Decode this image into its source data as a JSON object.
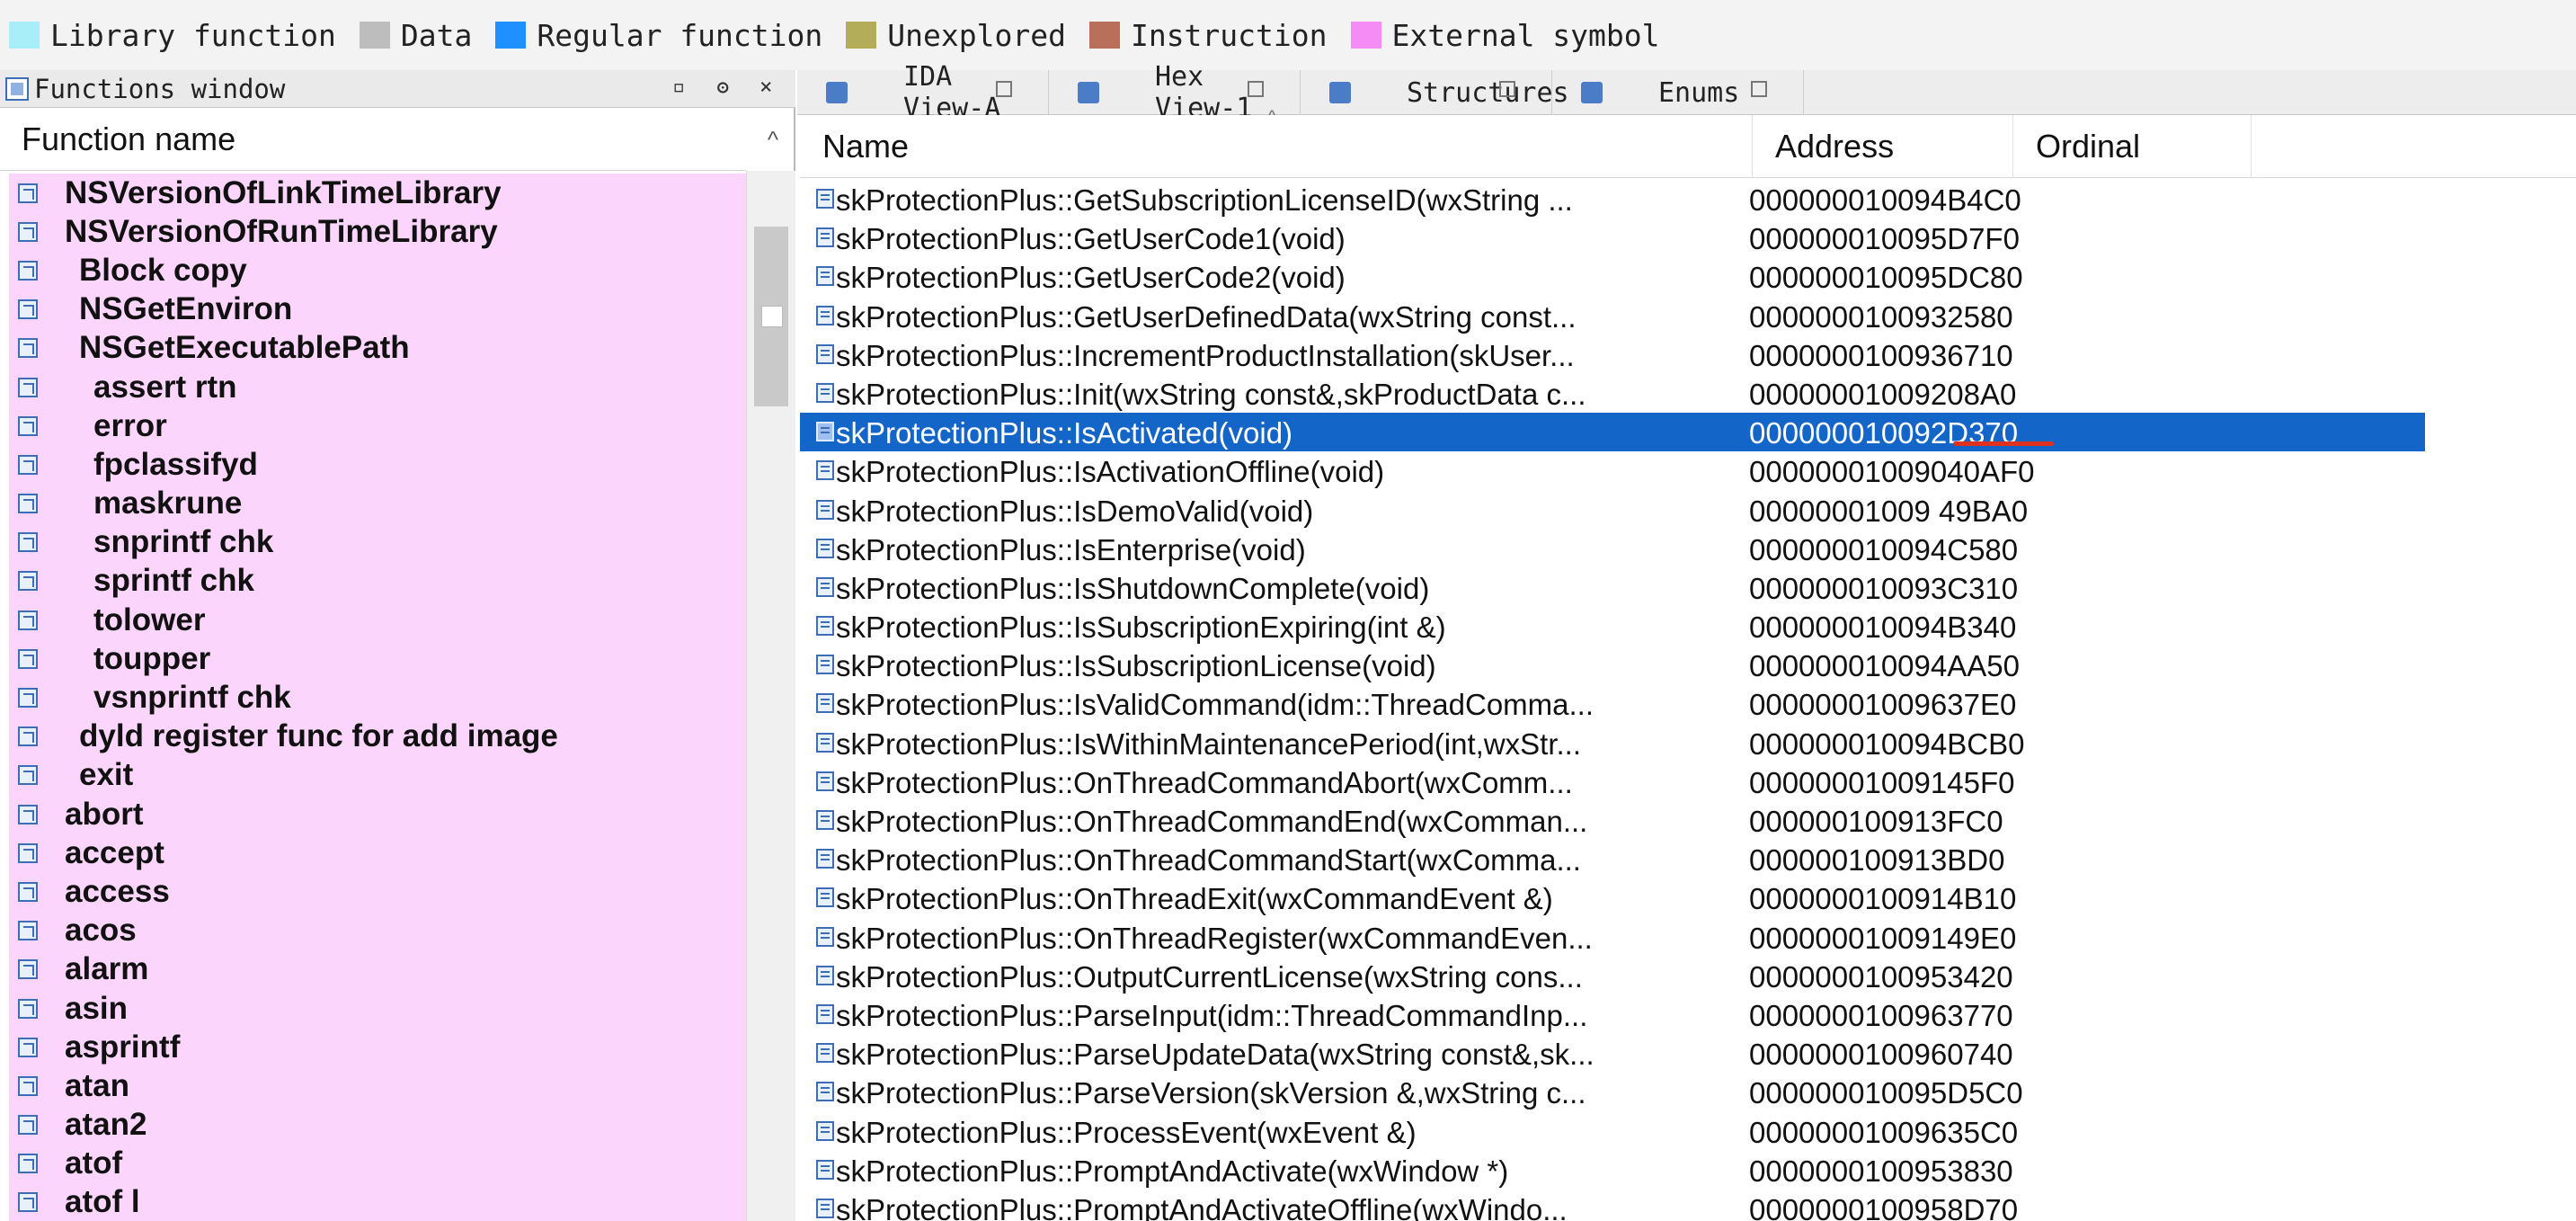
{
  "legend": [
    {
      "label": "Library function",
      "color": "#a8eef8"
    },
    {
      "label": "Data",
      "color": "#bdbdbd"
    },
    {
      "label": "Regular function",
      "color": "#1e90ff"
    },
    {
      "label": "Unexplored",
      "color": "#b3ad5a"
    },
    {
      "label": "Instruction",
      "color": "#b8705a"
    },
    {
      "label": "External symbol",
      "color": "#f58cf5"
    }
  ],
  "functions_window": {
    "title": "Functions window",
    "column_header": "Function name",
    "sort_glyph": "^",
    "controls": [
      "▫",
      "ʘ",
      "×"
    ],
    "items": [
      {
        "name": "NSVersionOfLinkTimeLibrary",
        "indent": 0
      },
      {
        "name": "NSVersionOfRunTimeLibrary",
        "indent": 0
      },
      {
        "name": "Block copy",
        "indent": 1
      },
      {
        "name": "NSGetEnviron",
        "indent": 1
      },
      {
        "name": "NSGetExecutablePath",
        "indent": 1
      },
      {
        "name": "assert rtn",
        "indent": 2
      },
      {
        "name": "error",
        "indent": 2
      },
      {
        "name": "fpclassifyd",
        "indent": 2
      },
      {
        "name": "maskrune",
        "indent": 2
      },
      {
        "name": "snprintf chk",
        "indent": 2
      },
      {
        "name": "sprintf chk",
        "indent": 2
      },
      {
        "name": "tolower",
        "indent": 2
      },
      {
        "name": "toupper",
        "indent": 2
      },
      {
        "name": "vsnprintf chk",
        "indent": 2
      },
      {
        "name": "dyld register func for add image",
        "indent": 1
      },
      {
        "name": "exit",
        "indent": 1
      },
      {
        "name": "abort",
        "indent": 0
      },
      {
        "name": "accept",
        "indent": 0
      },
      {
        "name": "access",
        "indent": 0
      },
      {
        "name": "acos",
        "indent": 0
      },
      {
        "name": "alarm",
        "indent": 0
      },
      {
        "name": "asin",
        "indent": 0
      },
      {
        "name": "asprintf",
        "indent": 0
      },
      {
        "name": "atan",
        "indent": 0
      },
      {
        "name": "atan2",
        "indent": 0
      },
      {
        "name": "atof",
        "indent": 0
      },
      {
        "name": "atof l",
        "indent": 0
      }
    ]
  },
  "tabs": [
    {
      "label": "IDA View-A",
      "icon": "ida-view-icon"
    },
    {
      "label": "Hex View-1",
      "icon": "hex-view-icon"
    },
    {
      "label": "Structures",
      "icon": "structures-icon"
    },
    {
      "label": "Enums",
      "icon": "enums-icon"
    }
  ],
  "table": {
    "columns": [
      "Name",
      "Address",
      "Ordinal"
    ],
    "rows": [
      {
        "name": "skProtectionPlus::GetSubscriptionLicenseID(wxString ...",
        "address": "000000010094B4C0"
      },
      {
        "name": "skProtectionPlus::GetUserCode1(void)",
        "address": "000000010095D7F0"
      },
      {
        "name": "skProtectionPlus::GetUserCode2(void)",
        "address": "000000010095DC80"
      },
      {
        "name": "skProtectionPlus::GetUserDefinedData(wxString const...",
        "address": "0000000100932580"
      },
      {
        "name": "skProtectionPlus::IncrementProductInstallation(skUser...",
        "address": "0000000100936710"
      },
      {
        "name": "skProtectionPlus::Init(wxString const&,skProductData c...",
        "address": "00000001009208A0"
      },
      {
        "name": "skProtectionPlus::IsActivated(void)",
        "address": "000000010092D370",
        "selected": true
      },
      {
        "name": "skProtectionPlus::IsActivationOffline(void)",
        "address": "00000001009040AF0"
      },
      {
        "name": "skProtectionPlus::IsDemoValid(void)",
        "address": "00000001009 49BA0"
      },
      {
        "name": "skProtectionPlus::IsEnterprise(void)",
        "address": "000000010094C580"
      },
      {
        "name": "skProtectionPlus::IsShutdownComplete(void)",
        "address": "000000010093C310"
      },
      {
        "name": "skProtectionPlus::IsSubscriptionExpiring(int &)",
        "address": "000000010094B340"
      },
      {
        "name": "skProtectionPlus::IsSubscriptionLicense(void)",
        "address": "000000010094AA50"
      },
      {
        "name": "skProtectionPlus::IsValidCommand(idm::ThreadComma...",
        "address": "00000001009637E0"
      },
      {
        "name": "skProtectionPlus::IsWithinMaintenancePeriod(int,wxStr...",
        "address": "000000010094BCB0"
      },
      {
        "name": "skProtectionPlus::OnThreadCommandAbort(wxComm...",
        "address": "00000001009145F0"
      },
      {
        "name": "skProtectionPlus::OnThreadCommandEnd(wxComman...",
        "address": "000000100913FC0"
      },
      {
        "name": "skProtectionPlus::OnThreadCommandStart(wxComma...",
        "address": "000000100913BD0"
      },
      {
        "name": "skProtectionPlus::OnThreadExit(wxCommandEvent &)",
        "address": "0000000100914B10"
      },
      {
        "name": "skProtectionPlus::OnThreadRegister(wxCommandEven...",
        "address": "00000001009149E0"
      },
      {
        "name": "skProtectionPlus::OutputCurrentLicense(wxString cons...",
        "address": "0000000100953420"
      },
      {
        "name": "skProtectionPlus::ParseInput(idm::ThreadCommandInp...",
        "address": "0000000100963770"
      },
      {
        "name": "skProtectionPlus::ParseUpdateData(wxString const&,sk...",
        "address": "0000000100960740"
      },
      {
        "name": "skProtectionPlus::ParseVersion(skVersion &,wxString c...",
        "address": "000000010095D5C0"
      },
      {
        "name": "skProtectionPlus::ProcessEvent(wxEvent &)",
        "address": "00000001009635C0"
      },
      {
        "name": "skProtectionPlus::PromptAndActivate(wxWindow *)",
        "address": "0000000100953830"
      },
      {
        "name": "skProtectionPlus::PromptAndActivateOffline(wxWindo...",
        "address": "0000000100958D70"
      }
    ]
  }
}
